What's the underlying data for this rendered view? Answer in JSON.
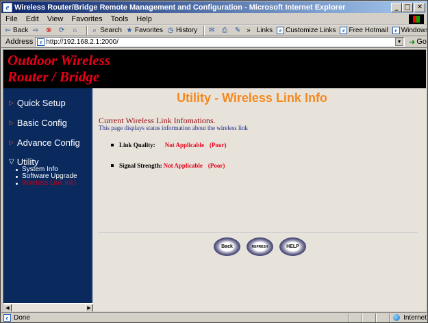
{
  "window": {
    "title": "Wireless Router/Bridge Remote Management and Configuration - Microsoft Internet Explorer"
  },
  "menu": [
    "File",
    "Edit",
    "View",
    "Favorites",
    "Tools",
    "Help"
  ],
  "toolbar": {
    "back": "Back",
    "search": "Search",
    "favorites": "Favorites",
    "history": "History",
    "chevron": "»",
    "links_label": "Links",
    "links": [
      "Customize Links",
      "Free Hotmail",
      "Windows"
    ]
  },
  "address": {
    "label": "Address",
    "url": "http://192.168.2.1:2000/",
    "go": "Go"
  },
  "banner": {
    "title": "Outdoor Wireless Router / Bridge"
  },
  "nav": {
    "items": [
      "Quick Setup",
      "Basic Config",
      "Advance Config"
    ],
    "open_item": "Utility",
    "sub_items": [
      "System Info",
      "Software Upgrade",
      "Wireless Link Info"
    ]
  },
  "main": {
    "title": "Utility - Wireless Link Info",
    "heading": "Current Wireless Link Infomations.",
    "description": "This page displays status information about the wireless link",
    "rows": [
      {
        "label": "Link Quality:",
        "value": "Not Applicable",
        "rating": "(Poor)"
      },
      {
        "label": "Signal Strength:",
        "value": "Not Applicable",
        "rating": "(Poor)"
      }
    ],
    "buttons": [
      "Back",
      "REFRESH",
      "HELP"
    ]
  },
  "status": {
    "left": "Done",
    "zone": "Internet"
  },
  "colors": {
    "banner_text": "#e8001a",
    "title_orange": "#f5881f",
    "nav_bg": "#0a2a5e",
    "value_red": "#e8001a"
  }
}
